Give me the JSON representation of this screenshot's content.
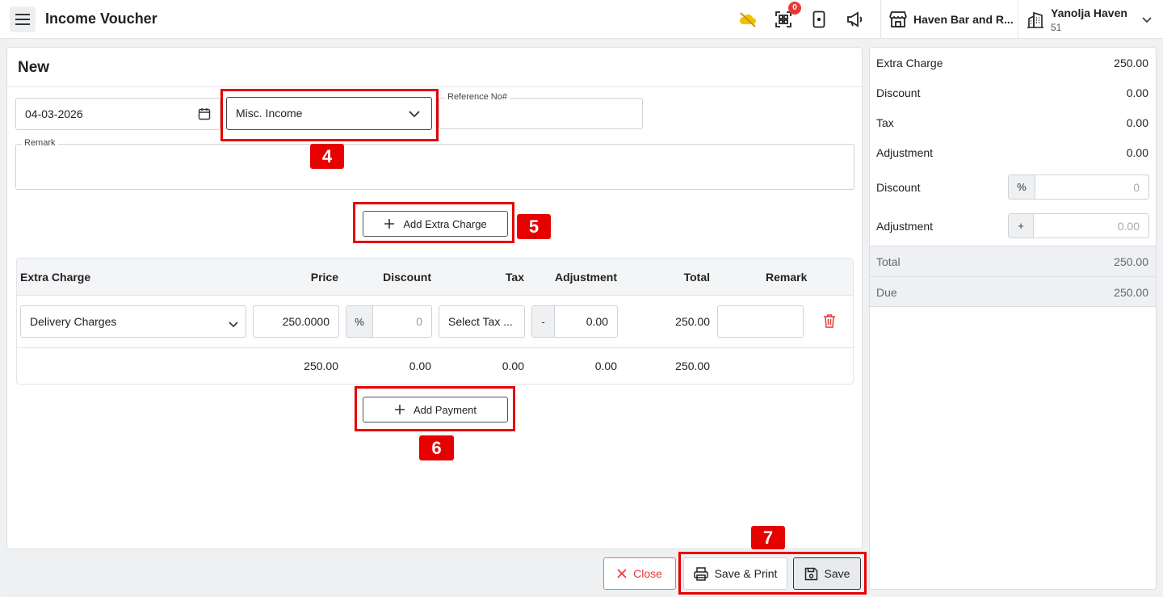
{
  "header": {
    "title": "Income Voucher",
    "qr_badge_count": "0",
    "hotel": "Haven Bar and R...",
    "user_name": "Yanolja Haven",
    "user_sub": "51"
  },
  "form": {
    "heading": "New",
    "date": "04-03-2026",
    "category": "Misc. Income",
    "reference_label": "Reference No#",
    "reference_value": "",
    "remark_label": "Remark",
    "add_extra_charge": "Add Extra Charge",
    "add_payment": "Add Payment"
  },
  "table": {
    "headers": {
      "extra_charge": "Extra Charge",
      "price": "Price",
      "discount": "Discount",
      "tax": "Tax",
      "adjustment": "Adjustment",
      "total": "Total",
      "remark": "Remark"
    },
    "row": {
      "charge": "Delivery Charges",
      "price": "250.0000",
      "discount_type": "%",
      "discount": "0",
      "tax": "Select Tax ...",
      "adjustment_sign": "-",
      "adjustment": "0.00",
      "total": "250.00",
      "remark": ""
    },
    "totals": {
      "price": "250.00",
      "discount": "0.00",
      "tax": "0.00",
      "adjustment": "0.00",
      "total": "250.00"
    }
  },
  "annotations": {
    "step4": "4",
    "step5": "5",
    "step6": "6",
    "step7": "7"
  },
  "footer": {
    "close": "Close",
    "save_print": "Save & Print",
    "save": "Save"
  },
  "summary": {
    "extra_charge_label": "Extra Charge",
    "extra_charge": "250.00",
    "discount_label": "Discount",
    "discount": "0.00",
    "tax_label": "Tax",
    "tax": "0.00",
    "adjustment_label": "Adjustment",
    "adjustment": "0.00",
    "discount_input_label": "Discount",
    "discount_input_type": "%",
    "discount_input_placeholder": "0",
    "adjustment_input_label": "Adjustment",
    "adjustment_input_sign": "+",
    "adjustment_input_placeholder": "0.00",
    "total_label": "Total",
    "total": "250.00",
    "due_label": "Due",
    "due": "250.00"
  },
  "colors": {
    "highlight": "#e60000",
    "danger": "#e53935",
    "cloud_icon": "#f2c200"
  }
}
